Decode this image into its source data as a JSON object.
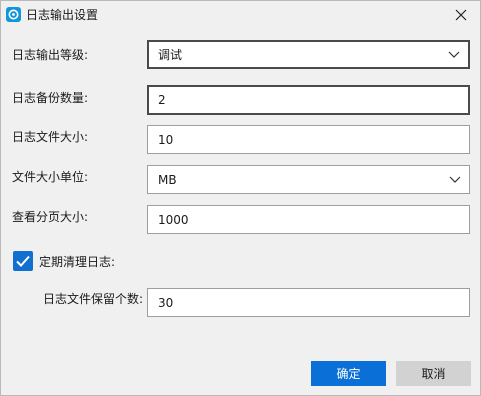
{
  "window": {
    "title": "日志输出设置"
  },
  "form": {
    "log_level": {
      "label": "日志输出等级:",
      "value": "调试"
    },
    "backup_count": {
      "label": "日志备份数量:",
      "value": "2"
    },
    "file_size": {
      "label": "日志文件大小:",
      "value": "10"
    },
    "size_unit": {
      "label": "文件大小单位:",
      "value": "MB"
    },
    "page_size": {
      "label": "查看分页大小:",
      "value": "1000"
    },
    "auto_clean": {
      "label": "定期清理日志:",
      "checked": true
    },
    "retention_count": {
      "label": "日志文件保留个数:",
      "value": "30"
    }
  },
  "buttons": {
    "ok": "确定",
    "cancel": "取消"
  },
  "colors": {
    "accent": "#0a6fd6",
    "checkbox": "#1170cf",
    "cancel_bg": "#d2d2d2"
  },
  "icons": [
    "app-icon",
    "close-icon",
    "chevron-down-icon",
    "checkmark-icon"
  ]
}
